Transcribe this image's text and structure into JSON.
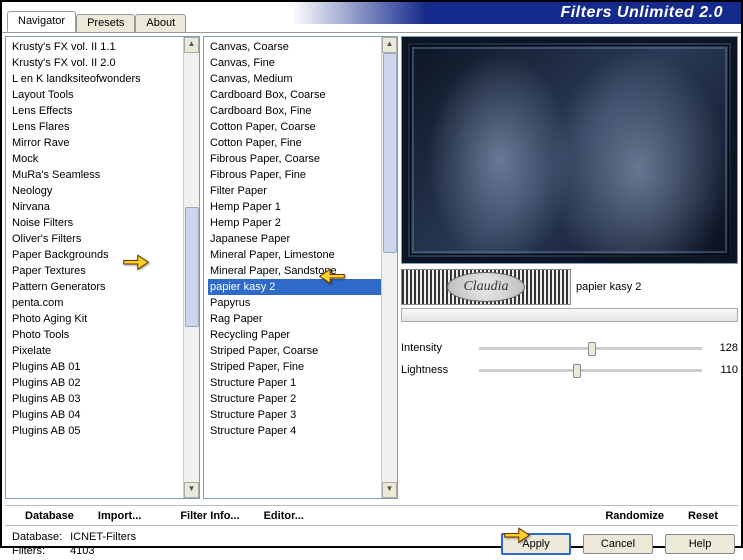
{
  "app_title": "Filters Unlimited 2.0",
  "tabs": {
    "navigator": "Navigator",
    "presets": "Presets",
    "about": "About"
  },
  "categories": [
    "Krusty's FX vol. II 1.1",
    "Krusty's FX vol. II 2.0",
    "L en K landksiteofwonders",
    "Layout Tools",
    "Lens Effects",
    "Lens Flares",
    "Mirror Rave",
    "Mock",
    "MuRa's Seamless",
    "Neology",
    "Nirvana",
    "Noise Filters",
    "Oliver's Filters",
    "Paper Backgrounds",
    "Paper Textures",
    "Pattern Generators",
    "penta.com",
    "Photo Aging Kit",
    "Photo Tools",
    "Pixelate",
    "Plugins AB 01",
    "Plugins AB 02",
    "Plugins AB 03",
    "Plugins AB 04",
    "Plugins AB 05"
  ],
  "filters": [
    "Canvas, Coarse",
    "Canvas, Fine",
    "Canvas, Medium",
    "Cardboard Box, Coarse",
    "Cardboard Box, Fine",
    "Cotton Paper, Coarse",
    "Cotton Paper, Fine",
    "Fibrous Paper, Coarse",
    "Fibrous Paper, Fine",
    "Filter Paper",
    "Hemp Paper 1",
    "Hemp Paper 2",
    "Japanese Paper",
    "Mineral Paper, Limestone",
    "Mineral Paper, Sandstone",
    "papier kasy 2",
    "Papyrus",
    "Rag Paper",
    "Recycling Paper",
    "Striped Paper, Coarse",
    "Striped Paper, Fine",
    "Structure Paper 1",
    "Structure Paper 2",
    "Structure Paper 3",
    "Structure Paper 4"
  ],
  "selected_filter_index": 15,
  "selected_filter_name": "papier kasy 2",
  "watermark_text": "Claudia",
  "params": {
    "intensity": {
      "label": "Intensity",
      "value": 128
    },
    "lightness": {
      "label": "Lightness",
      "value": 110
    }
  },
  "buttons_row": {
    "database": "Database",
    "import": "Import...",
    "filterinfo": "Filter Info...",
    "editor": "Editor...",
    "randomize": "Randomize",
    "reset": "Reset"
  },
  "footer": {
    "db_label": "Database:",
    "db_value": "ICNET-Filters",
    "filters_label": "Filters:",
    "filters_value": "4103",
    "apply": "Apply",
    "cancel": "Cancel",
    "help": "Help"
  }
}
